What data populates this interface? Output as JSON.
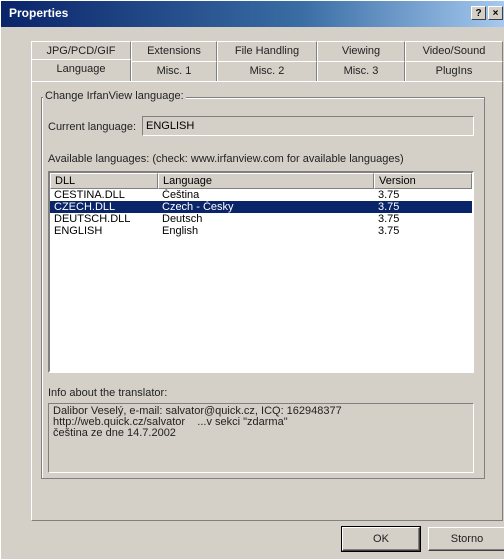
{
  "window": {
    "title": "Properties",
    "help_glyph": "?",
    "close_glyph": "×"
  },
  "tabs": {
    "row_back": [
      "JPG/PCD/GIF",
      "Extensions",
      "File Handling",
      "Viewing",
      "Video/Sound"
    ],
    "row_front": [
      "Language",
      "Misc. 1",
      "Misc. 2",
      "Misc. 3",
      "PlugIns"
    ],
    "active": "Language"
  },
  "language_group": {
    "legend": "Change IrfanView language:",
    "current_label": "Current language:",
    "current_value": "ENGLISH",
    "available_label": "Available languages: (check: www.irfanview.com for available languages)"
  },
  "list": {
    "columns": [
      "DLL",
      "Language",
      "Version"
    ],
    "rows": [
      {
        "dll": "CESTINA.DLL",
        "language": "Čeština",
        "version": "3.75",
        "selected": false
      },
      {
        "dll": "CZECH.DLL",
        "language": "Czech - Česky",
        "version": "3.75",
        "selected": true
      },
      {
        "dll": "DEUTSCH.DLL",
        "language": "Deutsch",
        "version": "3.75",
        "selected": false
      },
      {
        "dll": "ENGLISH",
        "language": "English",
        "version": "3.75",
        "selected": false
      }
    ]
  },
  "translator": {
    "label": "Info about the translator:",
    "lines": [
      "Dalibor Veselý, e-mail: salvator@quick.cz, ICQ: 162948377",
      "http://web.quick.cz/salvator    ...v sekci \"zdarma\"",
      "čeština ze dne 14.7.2002"
    ]
  },
  "buttons": {
    "ok": "OK",
    "cancel": "Storno"
  }
}
